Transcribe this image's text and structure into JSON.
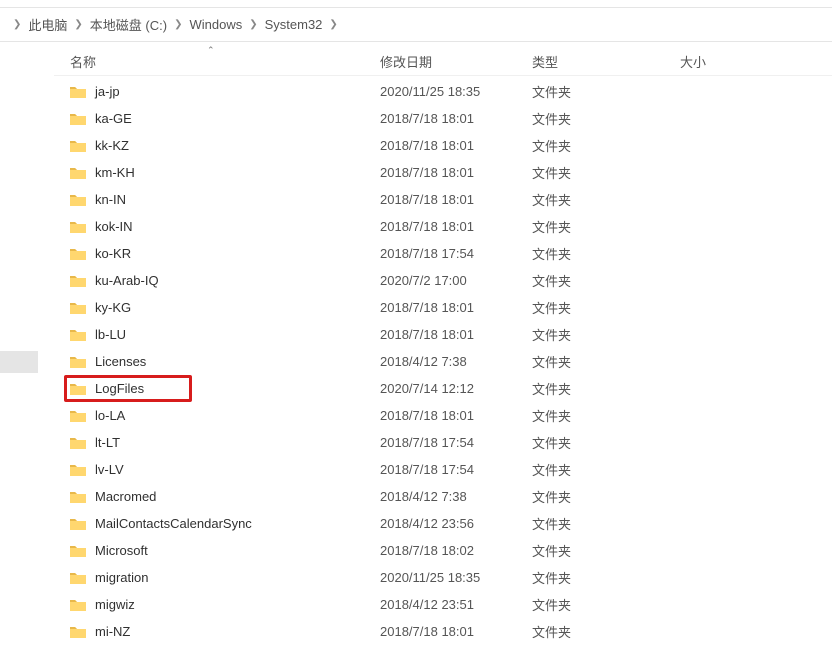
{
  "breadcrumb": {
    "items": [
      {
        "label": "此电脑"
      },
      {
        "label": "本地磁盘 (C:)"
      },
      {
        "label": "Windows"
      },
      {
        "label": "System32"
      }
    ]
  },
  "columns": {
    "name": "名称",
    "date": "修改日期",
    "type": "类型",
    "size": "大小"
  },
  "type_folder": "文件夹",
  "files": [
    {
      "name": "ja-jp",
      "date": "2020/11/25 18:35"
    },
    {
      "name": "ka-GE",
      "date": "2018/7/18 18:01"
    },
    {
      "name": "kk-KZ",
      "date": "2018/7/18 18:01"
    },
    {
      "name": "km-KH",
      "date": "2018/7/18 18:01"
    },
    {
      "name": "kn-IN",
      "date": "2018/7/18 18:01"
    },
    {
      "name": "kok-IN",
      "date": "2018/7/18 18:01"
    },
    {
      "name": "ko-KR",
      "date": "2018/7/18 17:54"
    },
    {
      "name": "ku-Arab-IQ",
      "date": "2020/7/2 17:00"
    },
    {
      "name": "ky-KG",
      "date": "2018/7/18 18:01"
    },
    {
      "name": "lb-LU",
      "date": "2018/7/18 18:01"
    },
    {
      "name": "Licenses",
      "date": "2018/4/12 7:38"
    },
    {
      "name": "LogFiles",
      "date": "2020/7/14 12:12",
      "highlight": true
    },
    {
      "name": "lo-LA",
      "date": "2018/7/18 18:01"
    },
    {
      "name": "lt-LT",
      "date": "2018/7/18 17:54"
    },
    {
      "name": "lv-LV",
      "date": "2018/7/18 17:54"
    },
    {
      "name": "Macromed",
      "date": "2018/4/12 7:38"
    },
    {
      "name": "MailContactsCalendarSync",
      "date": "2018/4/12 23:56"
    },
    {
      "name": "Microsoft",
      "date": "2018/7/18 18:02"
    },
    {
      "name": "migration",
      "date": "2020/11/25 18:35"
    },
    {
      "name": "migwiz",
      "date": "2018/4/12 23:51"
    },
    {
      "name": "mi-NZ",
      "date": "2018/7/18 18:01"
    }
  ]
}
